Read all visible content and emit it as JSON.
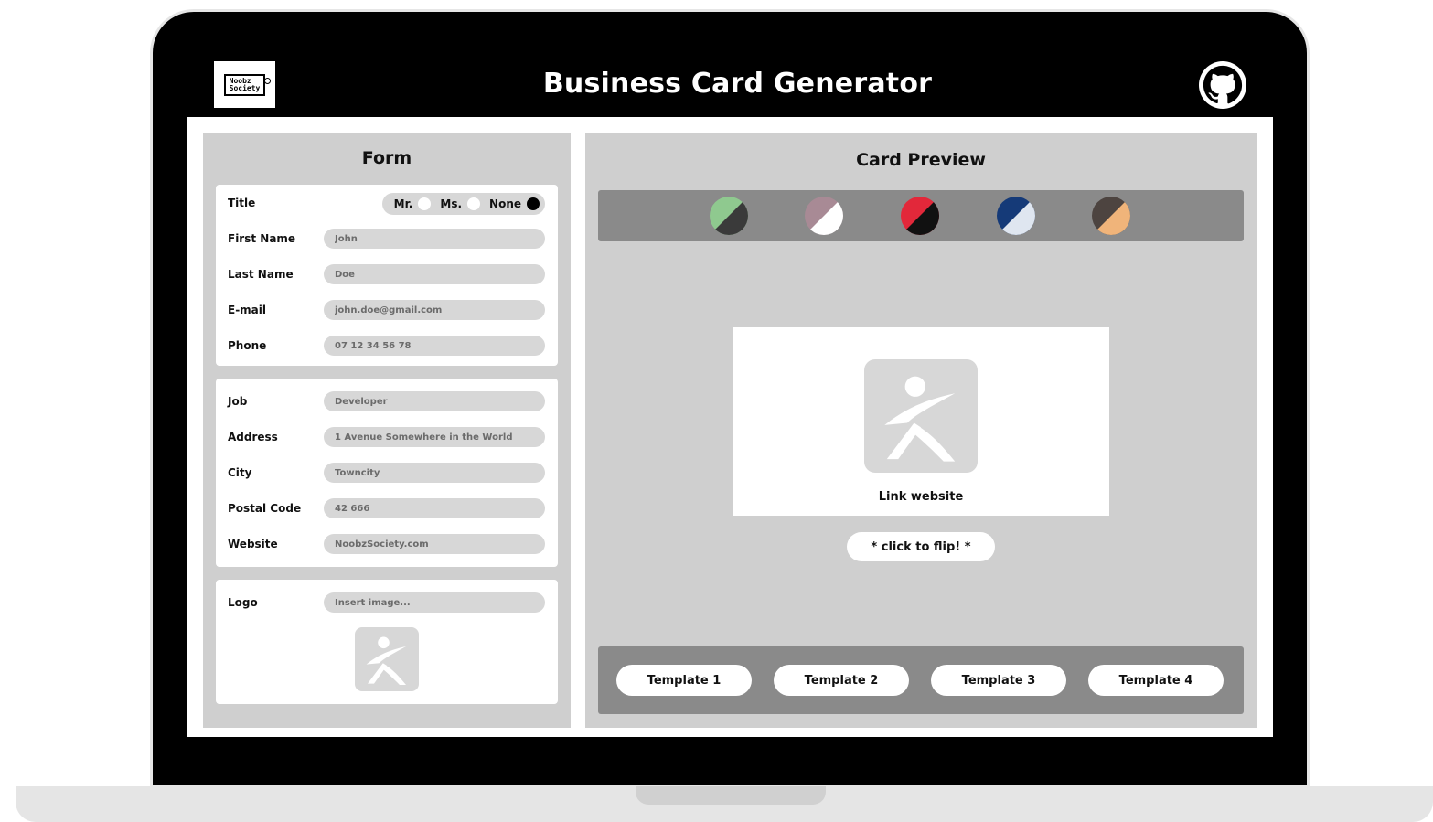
{
  "header": {
    "logo_text_line1": "Noobz",
    "logo_text_line2": "Society",
    "title": "Business Card Generator",
    "github_icon": "github-icon"
  },
  "form": {
    "title": "Form",
    "title_field": {
      "label": "Title",
      "options": [
        "Mr.",
        "Ms.",
        "None"
      ],
      "selected": "None"
    },
    "personal": [
      {
        "key": "first_name",
        "label": "First Name",
        "placeholder": "John"
      },
      {
        "key": "last_name",
        "label": "Last Name",
        "placeholder": "Doe"
      },
      {
        "key": "email",
        "label": "E-mail",
        "placeholder": "john.doe@gmail.com"
      },
      {
        "key": "phone",
        "label": "Phone",
        "placeholder": "07 12 34 56 78"
      }
    ],
    "professional": [
      {
        "key": "job",
        "label": "Job",
        "placeholder": "Developer"
      },
      {
        "key": "address",
        "label": "Address",
        "placeholder": "1 Avenue Somewhere in the World"
      },
      {
        "key": "city",
        "label": "City",
        "placeholder": "Towncity"
      },
      {
        "key": "postal_code",
        "label": "Postal Code",
        "placeholder": "42 666"
      },
      {
        "key": "website",
        "label": "Website",
        "placeholder": "NoobzSociety.com"
      }
    ],
    "logo": {
      "label": "Logo",
      "placeholder": "Insert image..."
    }
  },
  "preview": {
    "title": "Card Preview",
    "swatches": [
      {
        "name": "green-dark",
        "color_a": "#8fc98f",
        "color_b": "#3a3a3a"
      },
      {
        "name": "mauve-white",
        "color_a": "#a88a95",
        "color_b": "#ffffff"
      },
      {
        "name": "red-black",
        "color_a": "#e2283a",
        "color_b": "#111111"
      },
      {
        "name": "navy-white",
        "color_a": "#153a78",
        "color_b": "#dfe6f0"
      },
      {
        "name": "peach-brown",
        "color_a": "#4d4440",
        "color_b": "#f0b47a"
      }
    ],
    "card_link": "Link website",
    "flip_label": "* click to flip! *",
    "templates": [
      "Template 1",
      "Template 2",
      "Template 3",
      "Template 4"
    ]
  }
}
